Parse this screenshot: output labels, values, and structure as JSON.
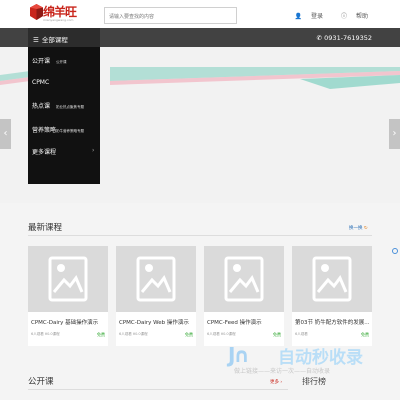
{
  "header": {
    "logo_text": "绵羊旺",
    "logo_sub": "mianyangwang.com",
    "search_placeholder": "请输入要查找的内容",
    "login": "登录",
    "help": "帮助"
  },
  "nav": {
    "all_courses": "全部课程",
    "phone": "0931-7619352"
  },
  "menu": [
    {
      "label": "公开课",
      "sub": "公开课",
      "chevron": false
    },
    {
      "label": "CPMC",
      "sub": "",
      "chevron": false
    },
    {
      "label": "热点课",
      "sub": "奶业热点聚焦专题",
      "chevron": false
    },
    {
      "label": "营养策略",
      "sub": "奶牛营养策略专题",
      "chevron": false
    },
    {
      "label": "更多课程",
      "sub": "",
      "chevron": true
    }
  ],
  "latest": {
    "title": "最新课程",
    "more": "换一换",
    "courses": [
      {
        "title": "CPMC-Dairy 基础操作演示",
        "meta": "6人观看   ¥0.0课程",
        "free": "免费"
      },
      {
        "title": "CPMC-Dairy Web 操作演示",
        "meta": "6人观看   ¥0.0课程",
        "free": "免费"
      },
      {
        "title": "CPMC-Feed 操作演示",
        "meta": "6人观看   ¥0.0课程",
        "free": "免费"
      },
      {
        "title": "第03节 奶牛配方软件的发展...",
        "meta": "6人观看",
        "free": "免费"
      }
    ]
  },
  "public": {
    "title": "公开课",
    "more": "更多 ›"
  },
  "ranking": "排行榜",
  "watermark": {
    "brand": "自动秒收录",
    "sub": "做上链接——来访一次——自动收录"
  },
  "colors": {
    "nav_bg": "#424242",
    "menu_bg": "#111111",
    "brand_red": "#c9261c",
    "stripe_teal": "#7fd0c0",
    "stripe_pink": "#f2a7b5"
  }
}
